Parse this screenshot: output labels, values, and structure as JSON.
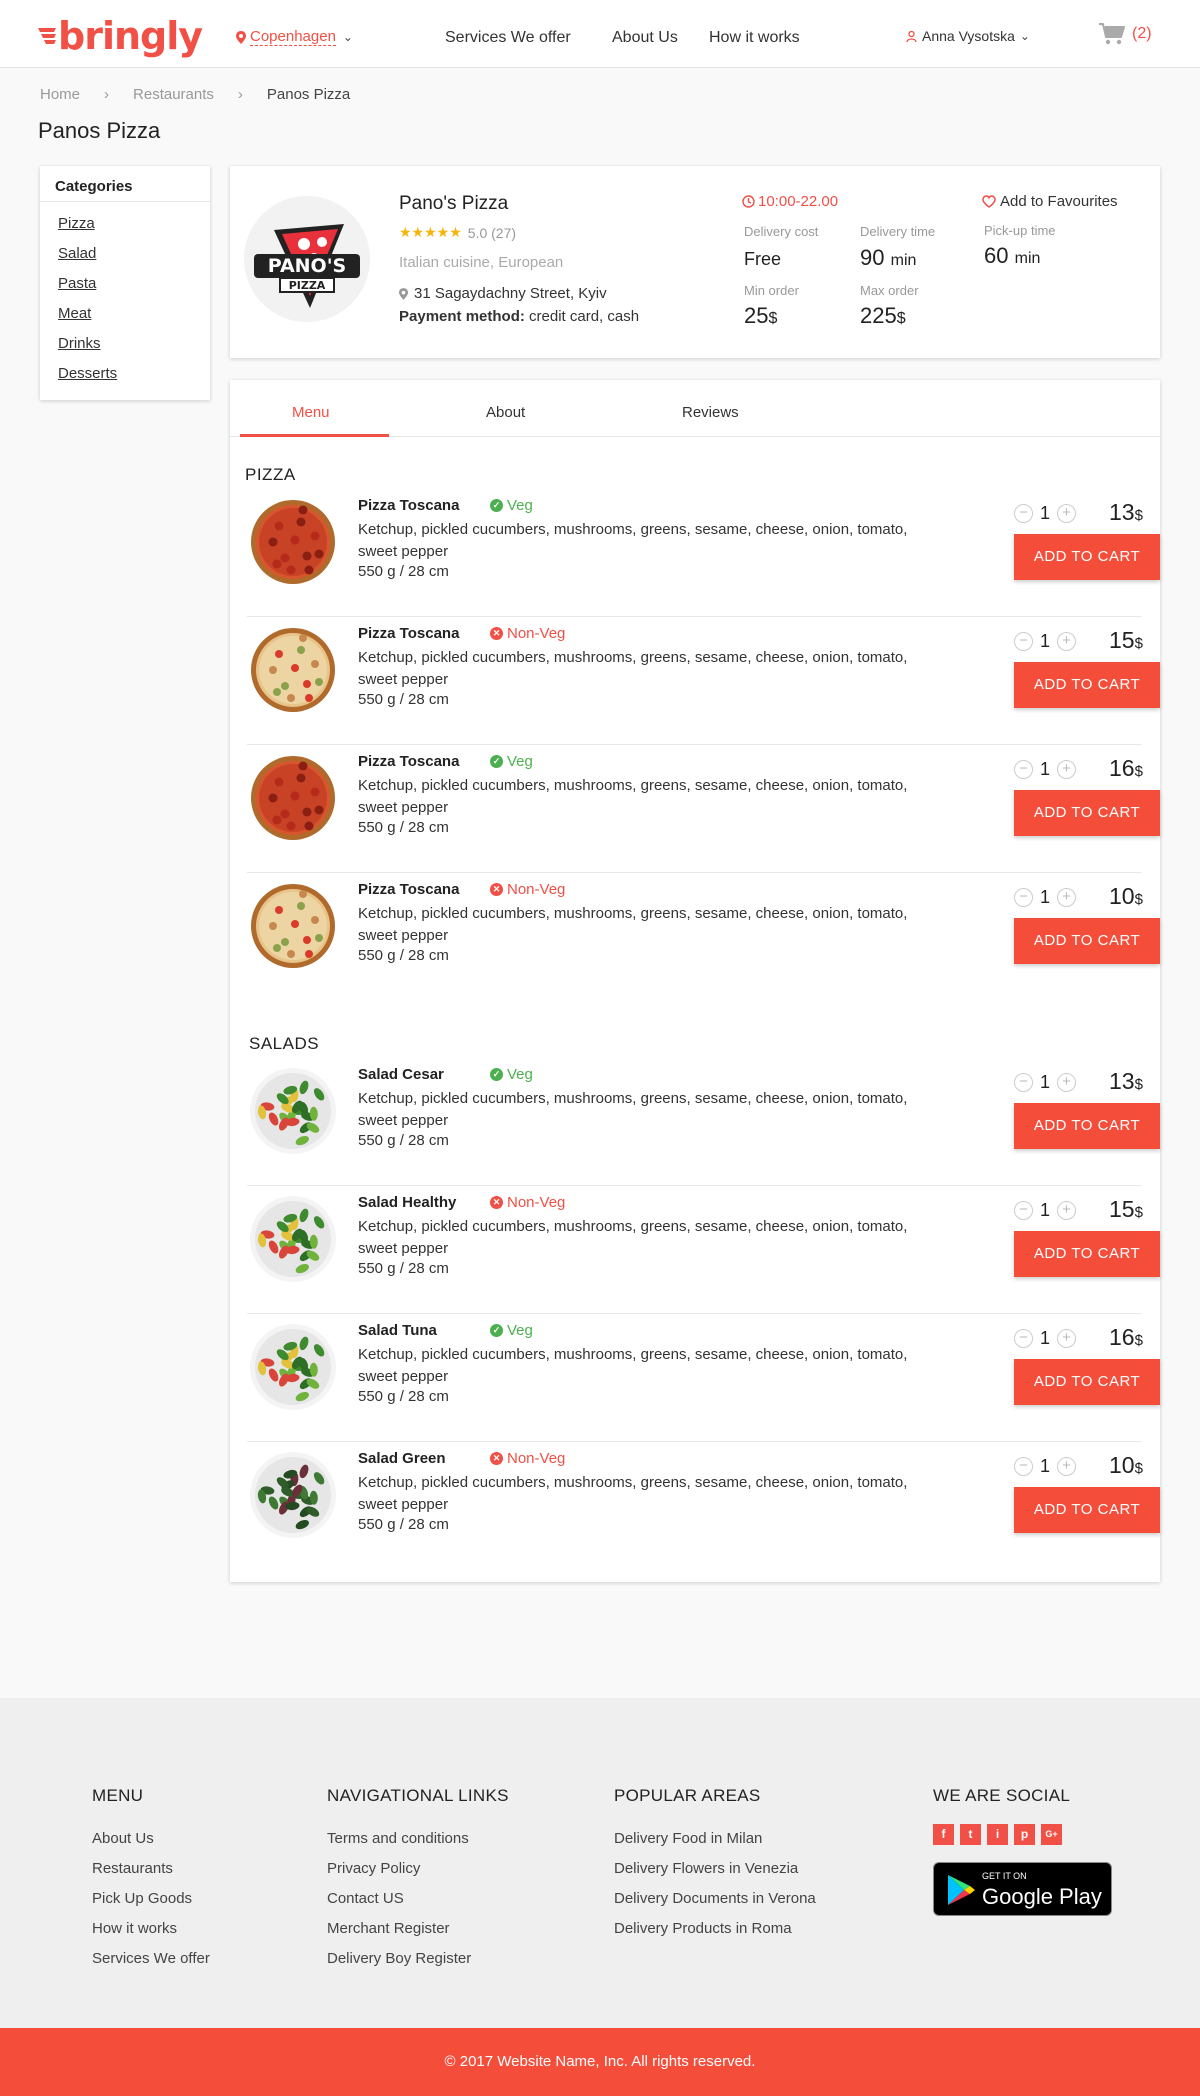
{
  "header": {
    "logo_text": "bringly",
    "city": "Copenhagen",
    "nav": [
      "Services  We offer",
      "About Us",
      "How it works"
    ],
    "user": "Anna Vysotska",
    "cart_count": "(2)"
  },
  "breadcrumb": [
    "Home",
    "Restaurants",
    "Panos Pizza"
  ],
  "page_title": "Panos Pizza",
  "categories": {
    "title": "Categories",
    "items": [
      "Pizza",
      "Salad",
      "Pasta",
      "Meat",
      "Drinks",
      "Desserts"
    ]
  },
  "restaurant": {
    "logo_text_1": "PANO'S",
    "logo_text_2": "PIZZA",
    "name": "Pano's Pizza",
    "stars": "★★★★★",
    "rating": "5.0 (27)",
    "cuisine": "Italian cuisine, European",
    "address": "31 Sagaydachny Street, Kyiv",
    "payment_label": "Payment method:",
    "payment_value": " credit card, cash",
    "hours": "10:00-22.00",
    "delivery_cost_label": "Delivery cost",
    "delivery_cost": "Free",
    "delivery_time_label": "Delivery time",
    "delivery_time": "90",
    "delivery_time_unit": "min",
    "pickup_label": "Pick-up time",
    "pickup_time": "60",
    "pickup_unit": "min",
    "min_order_label": "Min order",
    "min_order": "25",
    "max_order_label": "Max order",
    "max_order": "225",
    "currency": "$",
    "favourite": "Add to Favourites"
  },
  "tabs": [
    "Menu",
    "About",
    "Reviews"
  ],
  "sections": [
    {
      "title": "PIZZA",
      "items": [
        {
          "name": "Pizza Toscana",
          "tag": "Veg",
          "desc": "Ketchup, pickled cucumbers, mushrooms, greens, sesame, cheese, onion, tomato, sweet pepper",
          "weight": "550 g / 28 cm",
          "qty": "1",
          "price": "13"
        },
        {
          "name": "Pizza Toscana",
          "tag": "Non-Veg",
          "desc": "Ketchup, pickled cucumbers, mushrooms, greens, sesame, cheese, onion, tomato, sweet pepper",
          "weight": "550 g / 28 cm",
          "qty": "1",
          "price": "15"
        },
        {
          "name": "Pizza Toscana",
          "tag": "Veg",
          "desc": "Ketchup, pickled cucumbers, mushrooms, greens, sesame, cheese, onion, tomato, sweet pepper",
          "weight": "550 g / 28 cm",
          "qty": "1",
          "price": "16"
        },
        {
          "name": "Pizza Toscana",
          "tag": "Non-Veg",
          "desc": "Ketchup, pickled cucumbers, mushrooms, greens, sesame, cheese, onion, tomato, sweet pepper",
          "weight": "550 g / 28 cm",
          "qty": "1",
          "price": "10"
        }
      ]
    },
    {
      "title": "SALADS",
      "items": [
        {
          "name": "Salad Cesar",
          "tag": "Veg",
          "desc": "Ketchup, pickled cucumbers, mushrooms, greens, sesame, cheese, onion, tomato, sweet pepper",
          "weight": "550 g / 28 cm",
          "qty": "1",
          "price": "13"
        },
        {
          "name": "Salad Healthy",
          "tag": "Non-Veg",
          "desc": "Ketchup, pickled cucumbers, mushrooms, greens, sesame, cheese, onion, tomato, sweet pepper",
          "weight": "550 g / 28 cm",
          "qty": "1",
          "price": "15"
        },
        {
          "name": "Salad Tuna",
          "tag": "Veg",
          "desc": "Ketchup, pickled cucumbers, mushrooms, greens, sesame, cheese, onion, tomato, sweet pepper",
          "weight": "550 g / 28 cm",
          "qty": "1",
          "price": "16"
        },
        {
          "name": "Salad Green",
          "tag": "Non-Veg",
          "desc": "Ketchup, pickled cucumbers, mushrooms, greens, sesame, cheese, onion, tomato, sweet pepper",
          "weight": "550 g / 28 cm",
          "qty": "1",
          "price": "10"
        }
      ]
    }
  ],
  "add_to_cart": "ADD TO CART",
  "footer": {
    "menu": {
      "title": "MENU",
      "links": [
        "About Us",
        "Restaurants",
        "Pick Up Goods",
        "How it works",
        "Services We offer"
      ]
    },
    "nav": {
      "title": "NAVIGATIONAL LINKS",
      "links": [
        "Terms and conditions",
        "Privacy Policy",
        "Contact US",
        "Merchant Register",
        "Delivery Boy Register"
      ]
    },
    "areas": {
      "title": "POPULAR AREAS",
      "links": [
        "Delivery Food in Milan",
        "Delivery Flowers in Venezia",
        "Delivery Documents in Verona",
        "Delivery Products in Roma"
      ]
    },
    "social": {
      "title": "WE ARE SOCIAL",
      "icons": [
        "f",
        "t",
        "i",
        "p",
        "G+"
      ]
    },
    "gplay_small": "GET IT ON",
    "gplay_big": "Google Play"
  },
  "copyright": "© 2017 Website Name, Inc. All rights reserved.",
  "colors": {
    "accent": "#f05046",
    "veg": "#4caf50",
    "button": "#f44e3b"
  }
}
